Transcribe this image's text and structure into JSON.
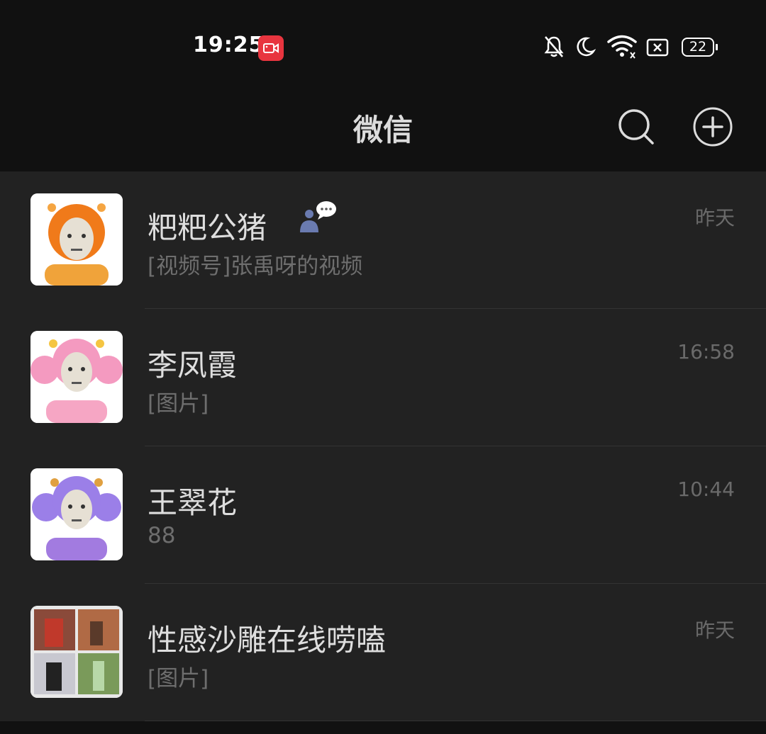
{
  "status_bar": {
    "time": "19:25",
    "battery": "22",
    "icons": [
      "screen-record-icon",
      "mute-bell-icon",
      "moon-icon",
      "wifi-icon",
      "no-sim-icon",
      "battery-icon"
    ]
  },
  "header": {
    "title": "微信",
    "icons": [
      "search-icon",
      "add-circle-icon"
    ]
  },
  "chats": [
    {
      "name": "粑粑公猪",
      "preview": "[视频号]张禹呀的视频",
      "time": "昨天",
      "badge_icon": "user-chat-bubble-icon"
    },
    {
      "name": "李凤霞",
      "preview": "[图片]",
      "time": "16:58"
    },
    {
      "name": "王翠花",
      "preview": "88",
      "time": "10:44"
    },
    {
      "name": "性感沙雕在线唠嗑",
      "preview": "[图片]",
      "time": "昨天"
    }
  ],
  "colors": {
    "background": "#111111",
    "list_background": "#222222",
    "record_badge": "#e8353f",
    "badge_person": "#6a7bb0"
  }
}
